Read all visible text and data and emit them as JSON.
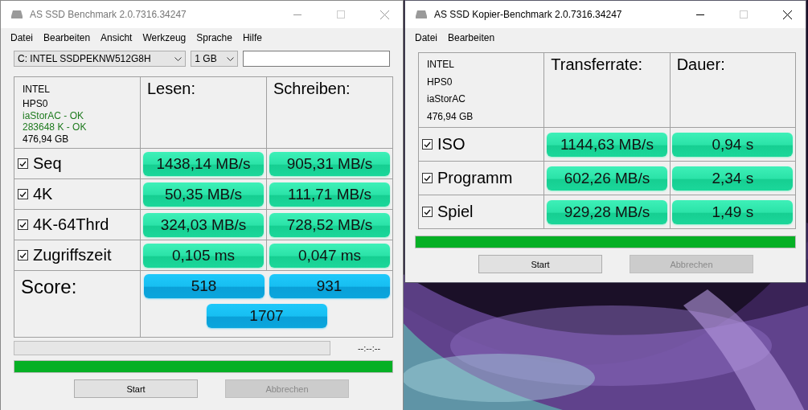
{
  "benchmark_window": {
    "title": "AS SSD Benchmark 2.0.7316.34247",
    "active": false,
    "menu": [
      "Datei",
      "Bearbeiten",
      "Ansicht",
      "Werkzeug",
      "Sprache",
      "Hilfe"
    ],
    "drive_select": {
      "value": "C: INTEL SSDPEKNW512G8H"
    },
    "size_select": {
      "value": "1 GB"
    },
    "info": [
      {
        "text": "INTEL",
        "ok": false
      },
      {
        "text": "HPS0",
        "ok": false
      },
      {
        "text": "iaStorAC - OK",
        "ok": true
      },
      {
        "text": "283648 K - OK",
        "ok": true
      },
      {
        "text": "476,94 GB",
        "ok": false
      }
    ],
    "columns": [
      "Lesen:",
      "Schreiben:"
    ],
    "rows": [
      {
        "label": "Seq",
        "checked": true,
        "values": [
          "1438,14 MB/s",
          "905,31 MB/s"
        ]
      },
      {
        "label": "4K",
        "checked": true,
        "values": [
          "50,35 MB/s",
          "111,71 MB/s"
        ]
      },
      {
        "label": "4K-64Thrd",
        "checked": true,
        "values": [
          "324,03 MB/s",
          "728,52 MB/s"
        ]
      },
      {
        "label": "Zugriffszeit",
        "checked": true,
        "values": [
          "0,105 ms",
          "0,047 ms"
        ]
      }
    ],
    "score": {
      "label": "Score:",
      "values": [
        "518",
        "931"
      ],
      "total": "1707"
    },
    "progress": {
      "level": 0,
      "time": "--:--:--"
    },
    "overall_progress": {
      "level": 1
    },
    "buttons": [
      {
        "label": "Start",
        "disabled": false
      },
      {
        "label": "Abbrechen",
        "disabled": true
      }
    ]
  },
  "copy_benchmark_window": {
    "title": "AS SSD Kopier-Benchmark 2.0.7316.34247",
    "active": true,
    "menu": [
      "Datei",
      "Bearbeiten"
    ],
    "info": [
      {
        "text": "INTEL",
        "ok": false
      },
      {
        "text": "HPS0",
        "ok": false
      },
      {
        "text": "iaStorAC",
        "ok": false
      },
      {
        "text": "476,94 GB",
        "ok": false
      }
    ],
    "columns": [
      "Transferrate:",
      "Dauer:"
    ],
    "rows": [
      {
        "label": "ISO",
        "checked": true,
        "values": [
          "1144,63 MB/s",
          "0,94 s"
        ]
      },
      {
        "label": "Programm",
        "checked": true,
        "values": [
          "602,26 MB/s",
          "2,34 s"
        ]
      },
      {
        "label": "Spiel",
        "checked": true,
        "values": [
          "929,28 MB/s",
          "1,49 s"
        ]
      }
    ],
    "overall_progress": {
      "level": 1
    },
    "buttons": [
      {
        "label": "Start",
        "disabled": false
      },
      {
        "label": "Abbrechen",
        "disabled": true
      }
    ]
  }
}
